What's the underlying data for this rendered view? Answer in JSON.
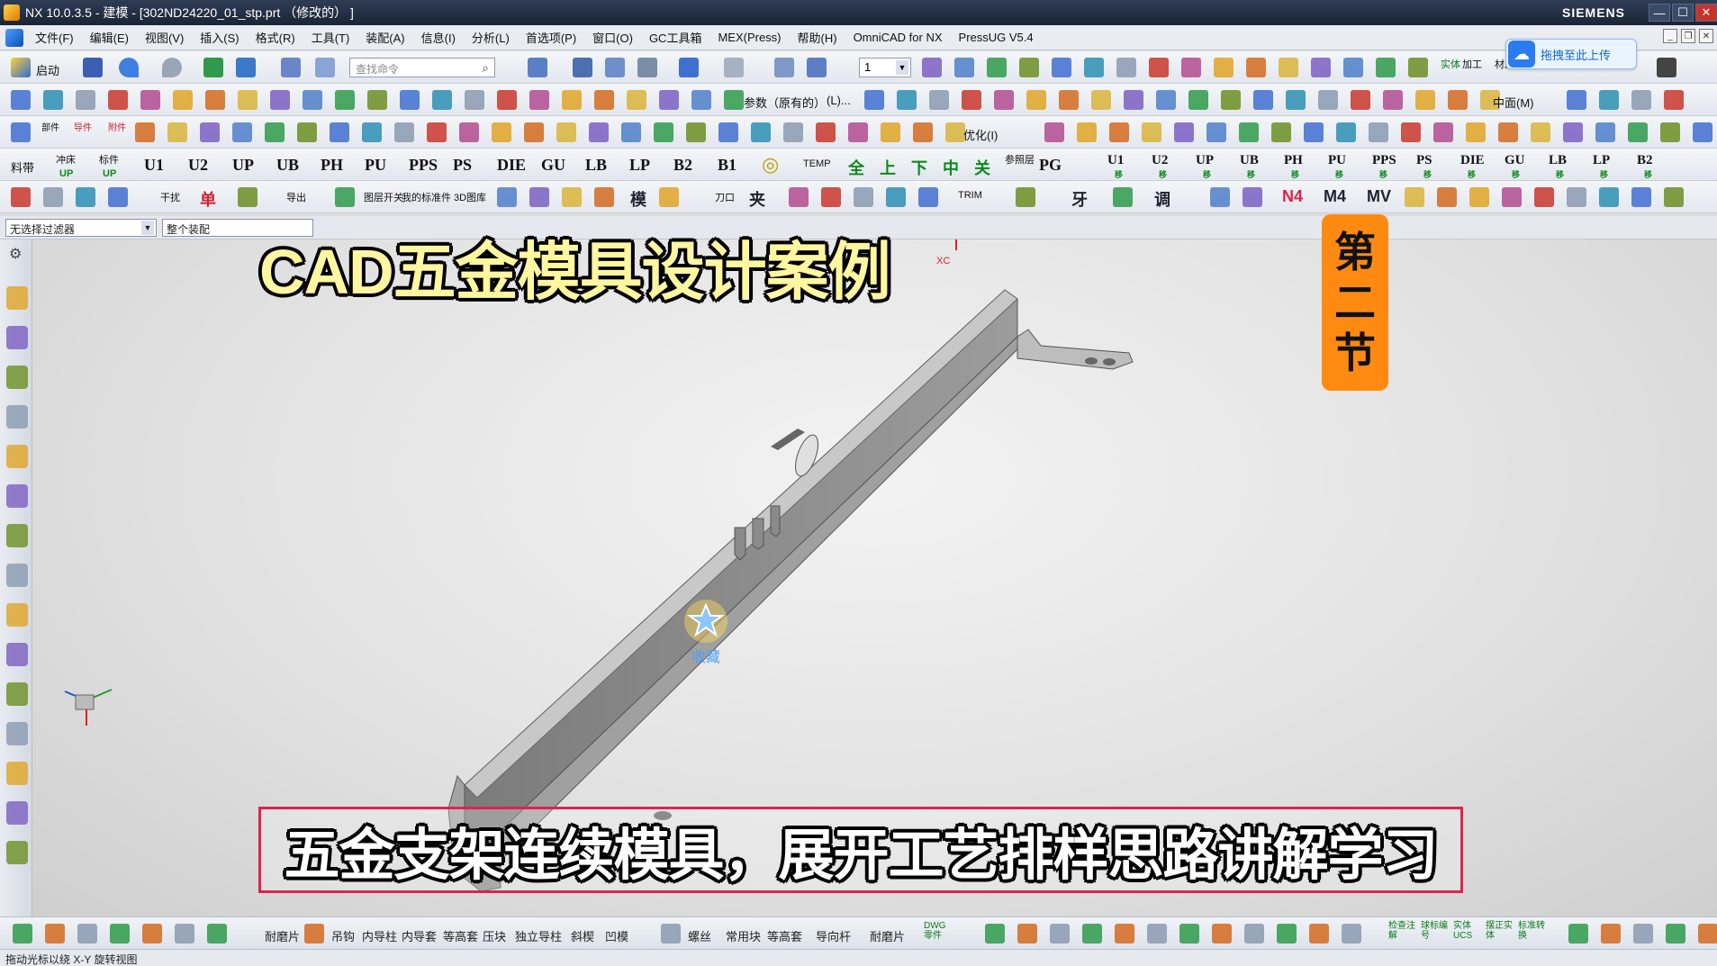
{
  "window": {
    "title": "NX 10.0.3.5 - 建模 - [302ND24220_01_stp.prt （修改的） ]",
    "brand": "SIEMENS"
  },
  "menu": [
    "文件(F)",
    "编辑(E)",
    "视图(V)",
    "插入(S)",
    "格式(R)",
    "工具(T)",
    "装配(A)",
    "信息(I)",
    "分析(L)",
    "首选项(P)",
    "窗口(O)",
    "GC工具箱",
    "MEX(Press)",
    "帮助(H)",
    "OmniCAD for NX",
    "PressUG V5.4"
  ],
  "upload_button": "拖拽至此上传",
  "toolbar1": {
    "start_label": "启动",
    "search_placeholder": "查找命令",
    "layer_value": "1",
    "right_labels": [
      "实体",
      "加工",
      "材质"
    ]
  },
  "toolbar2": {
    "param_label": "参数（原有的）",
    "left_label": "(L)...",
    "middle_label": "中面(M)"
  },
  "toolbar3": {
    "labels": [
      "部件",
      "导件",
      "附件",
      "优化(I)"
    ]
  },
  "toolbar4": {
    "left_labels": [
      "料带",
      "冲床",
      "标件"
    ],
    "sub_labels": [
      "UP",
      "UP"
    ],
    "codes": [
      "U1",
      "U2",
      "UP",
      "UB",
      "PH",
      "PU",
      "PPS",
      "PS",
      "DIE",
      "GU",
      "LB",
      "LP",
      "B2",
      "B1"
    ],
    "temp": "TEMP",
    "chinese_codes": [
      "全",
      "上",
      "下",
      "中",
      "关"
    ],
    "reference_label": "参照层",
    "pg": "PG",
    "codes_right": [
      "U1",
      "U2",
      "UP",
      "UB",
      "PH",
      "PU",
      "PPS",
      "PS",
      "DIE",
      "GU",
      "LB",
      "LP",
      "B2"
    ],
    "move_label": "移"
  },
  "toolbar5": {
    "labels": [
      "干扰",
      "单",
      "导出",
      "图层开关",
      "我的标准件",
      "3D图库",
      "模",
      "刀口",
      "夹",
      "TRIM",
      "牙",
      "调",
      "N4",
      "M4",
      "MV"
    ]
  },
  "filters": {
    "type_filter": "无选择过滤器",
    "scope_filter": "整个装配"
  },
  "overlays": {
    "title_main": "CAD五金模具设计案例",
    "section_chars": [
      "第",
      "二",
      "节"
    ],
    "caption": "五金支架连续模具，展开工艺排样思路讲解学习",
    "favorite_label": "收藏",
    "axis_label": "XC"
  },
  "bottom_toolbar": {
    "labels": [
      "耐磨片",
      "吊钩",
      "内导柱",
      "内导套",
      "等高套",
      "压块",
      "独立导柱",
      "斜楔",
      "凹模",
      "螺丝",
      "常用块",
      "等高套",
      "导向杆",
      "耐磨片",
      "DWG零件",
      "检查注解",
      "球标编号",
      "实体UCS",
      "摆正实体",
      "标准转换"
    ]
  },
  "status_bar": "拖动光标以绕 X-Y 旋转视图",
  "colors": {
    "accent_orange": "#ff8a12",
    "caption_border": "#e0234e",
    "title_yellow": "#ffe13a"
  }
}
